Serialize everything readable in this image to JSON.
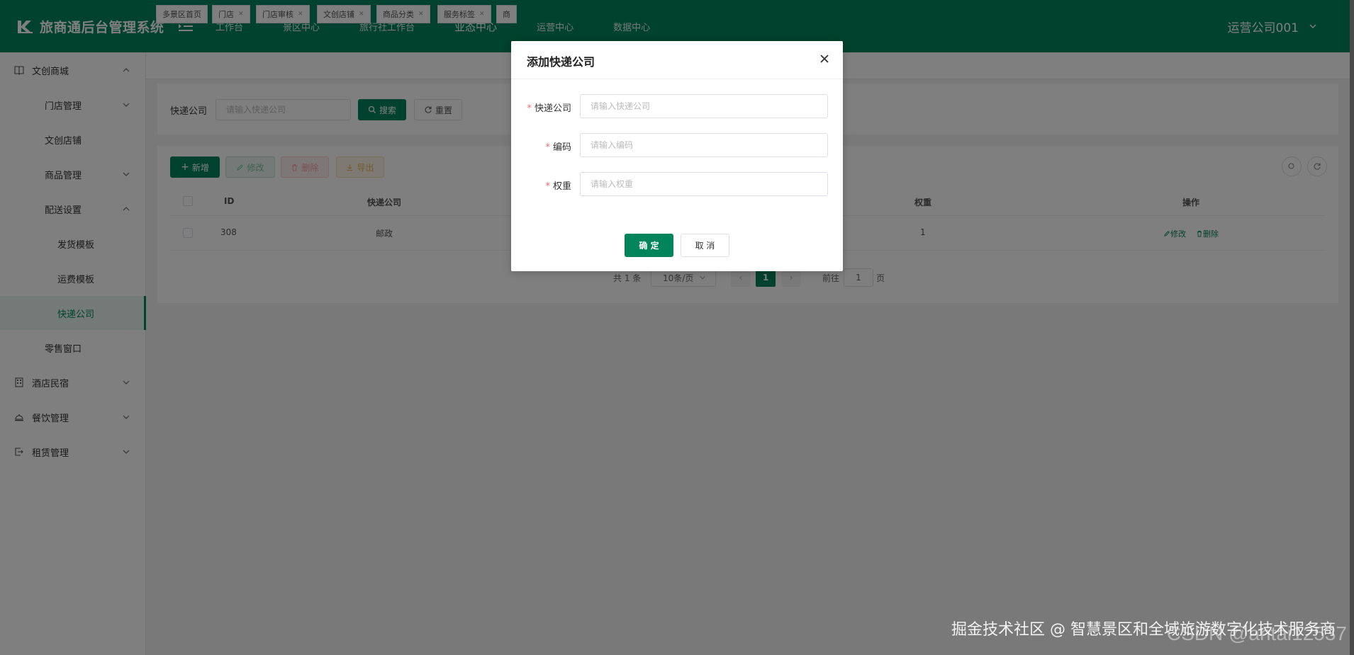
{
  "app": {
    "title": "旅商通后台管理系统",
    "user": "运营公司001"
  },
  "topnav": [
    "工作台",
    "景区中心",
    "旅行社工作台",
    "业态中心",
    "运营中心",
    "数据中心"
  ],
  "sidebar": {
    "items": [
      {
        "label": "文创商城"
      },
      {
        "label": "门店管理"
      },
      {
        "label": "文创店铺"
      },
      {
        "label": "商品管理"
      },
      {
        "label": "配送设置"
      },
      {
        "label": "发货模板"
      },
      {
        "label": "运费模板"
      },
      {
        "label": "快递公司"
      },
      {
        "label": "零售窗口"
      },
      {
        "label": "酒店民宿"
      },
      {
        "label": "餐饮管理"
      },
      {
        "label": "租赁管理"
      }
    ]
  },
  "tags": [
    "多景区首页",
    "门店",
    "门店审核",
    "文创店铺",
    "商品分类",
    "服务标签",
    "商"
  ],
  "search": {
    "label": "快递公司",
    "placeholder": "请输入快递公司",
    "search_btn": "搜索",
    "reset_btn": "重置"
  },
  "toolbar": {
    "add": "新增",
    "edit": "修改",
    "delete": "删除",
    "export": "导出"
  },
  "table": {
    "headers": {
      "id": "ID",
      "company": "快递公司",
      "weight": "权重",
      "ops": "操作"
    },
    "rows": [
      {
        "id": "308",
        "company": "邮政",
        "weight": "1",
        "edit": "修改",
        "delete": "删除"
      }
    ]
  },
  "pagination": {
    "total": "共 1 条",
    "page_size": "10条/页",
    "current": "1",
    "goto_label": "前往",
    "goto_value": "1",
    "page_unit": "页"
  },
  "dialog": {
    "title": "添加快递公司",
    "fields": [
      {
        "label": "快递公司",
        "placeholder": "请输入快递公司"
      },
      {
        "label": "编码",
        "placeholder": "请输入编码"
      },
      {
        "label": "权重",
        "placeholder": "请输入权重"
      }
    ],
    "confirm": "确 定",
    "cancel": "取 消"
  },
  "watermark": {
    "a": "CSDN @antai12537",
    "b": "掘金技术社区 @ 智慧景区和全域旅游数字化技术服务商"
  },
  "colors": {
    "brand": "#00855a",
    "required": "#f56c6c"
  }
}
